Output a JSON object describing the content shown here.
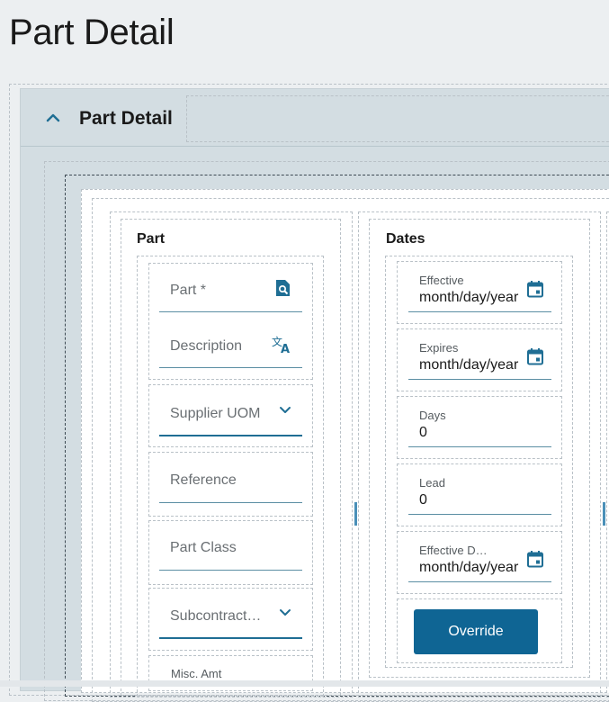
{
  "page": {
    "title": "Part Detail"
  },
  "panel": {
    "title": "Part Detail",
    "collapse_icon": "chevron-up-icon"
  },
  "part_group": {
    "title": "Part",
    "fields": {
      "part": {
        "placeholder": "Part *",
        "icon": "part-search-icon"
      },
      "description": {
        "placeholder": "Description",
        "icon": "translate-icon"
      },
      "supplier_uom": {
        "placeholder": "Supplier UOM",
        "icon": "chevron-down-icon"
      },
      "reference": {
        "placeholder": "Reference"
      },
      "part_class": {
        "placeholder": "Part Class"
      },
      "subcontract": {
        "placeholder": "Subcontract…",
        "icon": "chevron-down-icon"
      },
      "misc_amt": {
        "label": "Misc. Amt"
      }
    }
  },
  "dates_group": {
    "title": "Dates",
    "fields": {
      "effective": {
        "label": "Effective",
        "value": "month/day/year",
        "icon": "calendar-icon"
      },
      "expires": {
        "label": "Expires",
        "value": "month/day/year",
        "icon": "calendar-icon"
      },
      "days": {
        "label": "Days",
        "value": "0"
      },
      "lead": {
        "label": "Lead",
        "value": "0"
      },
      "effective_d": {
        "label": "Effective D…",
        "value": "month/day/year",
        "icon": "calendar-icon"
      }
    },
    "override_label": "Override"
  },
  "colors": {
    "accent": "#0f6594",
    "panel_bg": "#d3dde2",
    "page_bg": "#eceff1"
  }
}
